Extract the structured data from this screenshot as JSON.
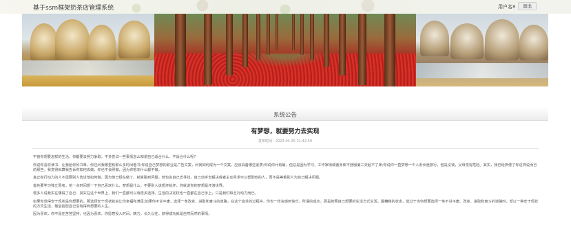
{
  "header": {
    "app_title": "基于ssm框架奶茶店管理系统",
    "user_name": "用户名8",
    "logout_label": "退出"
  },
  "carousel": {
    "slide_count": 3,
    "active_index": 1
  },
  "notice": {
    "section_title": "系统公告",
    "article_title": "有梦想，就要努力去实现",
    "publish_time": "发布时间：2023-04-25 21:42:59",
    "paragraphs": [
      "不管你想要怎样的生活，你都要去努力争取，不多尝试一些事情怎么知道自己适合什么、不适合什么呢?",
      "你说你喜欢读书，让我给你列书单，你还问我哪里有那么多时间看书;你说自己梦想的职业是广告文案，问我如何成为一个文案，应该具备哪些素质;你说你计划最，但总是因为学习、工作家琐或者身体不舒服第二天起不了床;你说你一直梦想一个人去长途旅行，但是没钱，父母觉得危险。其实，我已经厌倦了你这样说而已的那些，我觉得就算我告诉你如何去做，你也不会照做，因为你根本什么都不做。",
      "真正有行动力的人不需要别人告诉他如何做，因为他已经在做了。就算碰到问题，他也会自己去寻找，自己动手去解决或者主动寻求可以帮助他的人，而不是等着别人为自己解决问题。",
      "首先要学习独立思考。花一点时间想一下自己喜欢什么，梦想是什么，不要别人说想坏就坏，你就说你的梦想是坏游世界。",
      "很多人说我实在懂得了自己、其实在这个世界上，我们一直都可以有很多选择。生活的决定权也一直都在自己手上，只是我们缺乏行动力而已。",
      "如果你觉得安于现状是你想要的，那选择安于现状就会让你幸福和满足;如果你不甘平庸，选择一条改变、进取和奋斗的道路，在这个追求的过程中，你也一样会感到快乐。所谓的成功，即是按照自己想要的生活方式生活。最糟糕的状态，莫过于当你想要选择一条不甘平庸、改变、进取和奋斗的道路时，却以一种安于现状的方式生活，最后抱怨自己没有得到想要的人生。",
      "因为喜欢，你不是在苦苦坚持，也因为喜欢，你愿意投入时间、精力，长久以往，获得成功就是自然而然的事情。"
    ]
  }
}
